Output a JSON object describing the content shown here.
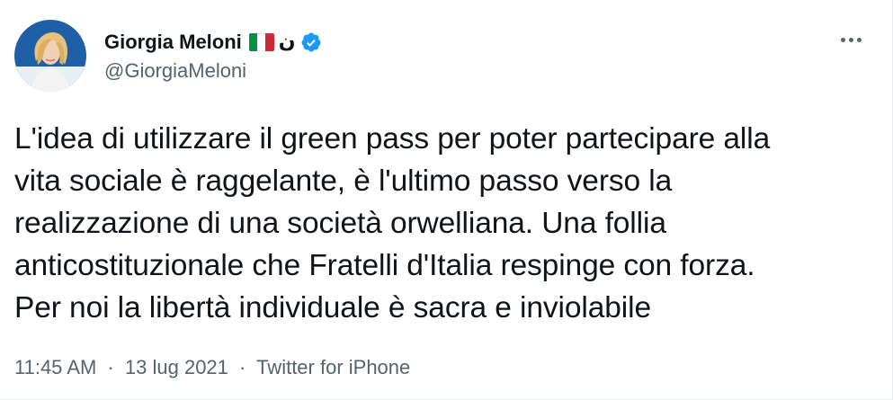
{
  "tweet": {
    "author": {
      "display_name": "Giorgia Meloni",
      "flag_icon": "italy-flag-icon",
      "flag_colors": [
        "#009246",
        "#ffffff",
        "#ce2b37"
      ],
      "arabic_glyph": "ن",
      "verified_icon": "verified-badge-icon",
      "verified_color": "#1d9bf0",
      "handle": "@GiorgiaMeloni"
    },
    "more_icon": "more-options-icon",
    "text": "L'idea di utilizzare il green pass per poter partecipare alla\nvita sociale è raggelante, è l'ultimo passo verso la\nrealizzazione di una società orwelliana. Una follia\nanticostituzionale che Fratelli d'Italia respinge con forza.\nPer noi la libertà individuale è sacra e inviolabile",
    "time": "11:45 AM",
    "separator": "·",
    "date": "13 lug 2021",
    "source": "Twitter for iPhone"
  }
}
